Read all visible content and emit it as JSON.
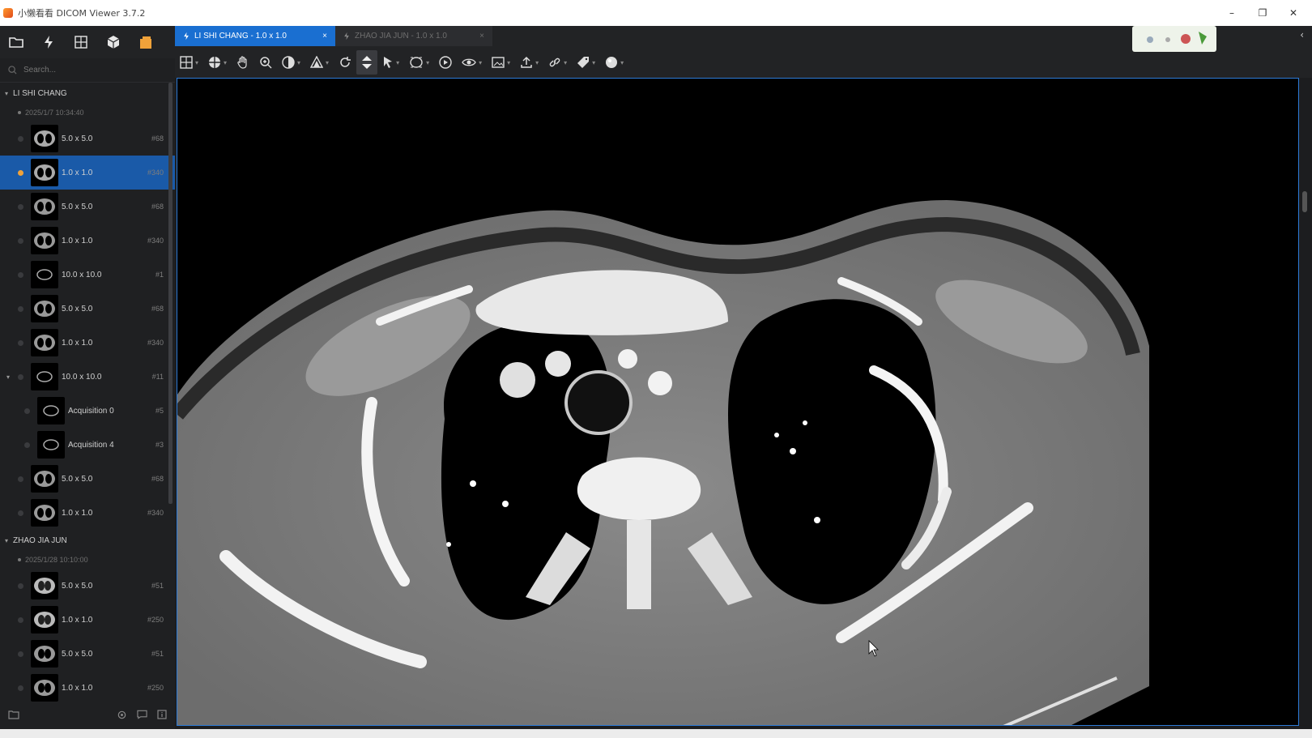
{
  "window": {
    "title": "小懒看看 DICOM Viewer 3.7.2",
    "controls": {
      "minimize": "–",
      "restore": "❐",
      "close": "✕"
    }
  },
  "tabs": [
    {
      "label": "LI SHI CHANG - 1.0 x 1.0",
      "close": "×"
    },
    {
      "label": "ZHAO JIA JUN - 1.0 x 1.0",
      "close": "×"
    }
  ],
  "sidebar": {
    "search_placeholder": "Search...",
    "patients": [
      {
        "name": "LI SHI CHANG",
        "study_date": "2025/1/7 10:34:40",
        "series": [
          {
            "label": "5.0 x 5.0",
            "count": "#68"
          },
          {
            "label": "1.0 x 1.0",
            "count": "#340"
          },
          {
            "label": "5.0 x 5.0",
            "count": "#68"
          },
          {
            "label": "1.0 x 1.0",
            "count": "#340"
          },
          {
            "label": "10.0 x 10.0",
            "count": "#1"
          },
          {
            "label": "5.0 x 5.0",
            "count": "#68"
          },
          {
            "label": "1.0 x 1.0",
            "count": "#340"
          },
          {
            "label": "10.0 x 10.0",
            "count": "#11"
          },
          {
            "label": "Acquisition 0",
            "count": "#5"
          },
          {
            "label": "Acquisition 4",
            "count": "#3"
          },
          {
            "label": "5.0 x 5.0",
            "count": "#68"
          },
          {
            "label": "1.0 x 1.0",
            "count": "#340"
          }
        ]
      },
      {
        "name": "ZHAO JIA JUN",
        "study_date": "2025/1/28 10:10:00",
        "series": [
          {
            "label": "5.0 x 5.0",
            "count": "#51"
          },
          {
            "label": "1.0 x 1.0",
            "count": "#250"
          },
          {
            "label": "5.0 x 5.0",
            "count": "#51"
          },
          {
            "label": "1.0 x 1.0",
            "count": "#250"
          }
        ]
      }
    ]
  },
  "colors": {
    "accent": "#1a6fd1",
    "selected_row": "#1a5aa8",
    "viewport_border": "#2d7ad6",
    "active_dot": "#f0a23a"
  }
}
